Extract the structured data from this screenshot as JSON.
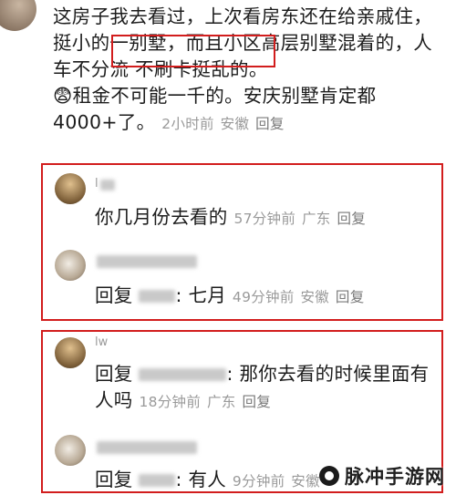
{
  "main_comment": {
    "text_part1": "这房子我去看过，上次看房东还在给亲戚住，",
    "highlight": "挺小的一别墅",
    "text_part2": "，而且小区高层别墅混着的，人车不分流 不刷卡挺乱的。",
    "emoji": "😨",
    "text_part3": "租金不可能一千的。安庆别墅肯定都4000+了。",
    "time": "2小时前",
    "location": "安徽",
    "reply_label": "回复"
  },
  "replies": [
    {
      "username": "l",
      "text": "你几月份去看的",
      "time": "57分钟前",
      "location": "广东",
      "reply_label": "回复"
    },
    {
      "prefix": "回复",
      "text": "七月",
      "time": "49分钟前",
      "location": "安徽",
      "reply_label": "回复"
    },
    {
      "username": "lw",
      "prefix": "回复",
      "text": "那你去看的时候里面有人吗",
      "time": "18分钟前",
      "location": "广东",
      "reply_label": "回复"
    },
    {
      "prefix": "回复",
      "text": "有人",
      "time": "9分钟前",
      "location": "安徽"
    }
  ],
  "watermark": {
    "text": "脉冲手游网"
  },
  "colors": {
    "highlight_border": "#d21d1d",
    "meta_text": "#9a9a9a"
  }
}
